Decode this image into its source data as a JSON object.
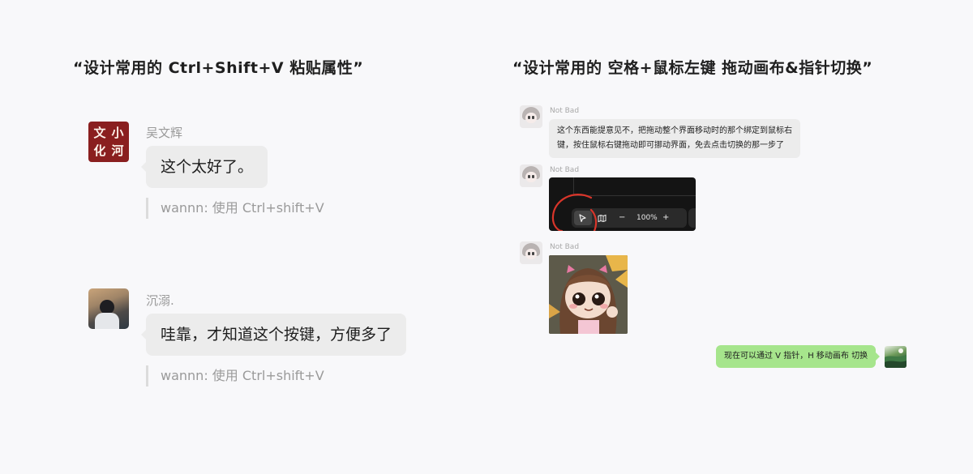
{
  "left": {
    "title": "“设计常用的 Ctrl+Shift+V 粘贴属性”",
    "messages": [
      {
        "avatar_text": [
          "文",
          "小",
          "化",
          "河"
        ],
        "name": "吴文辉",
        "text": "这个太好了。",
        "quote": "wannn: 使用 Ctrl+shift+V"
      },
      {
        "name": "沉溺.",
        "text": "哇靠，才知道这个按键，方便多了",
        "quote": "wannn: 使用 Ctrl+shift+V"
      }
    ]
  },
  "right": {
    "title": "“设计常用的 空格+鼠标左键 拖动画布&指针切换”",
    "messages": [
      {
        "name": "Not Bad",
        "lines": [
          "这个东西能提意见不，把拖动整个界面移动时的那个绑定到鼠标右",
          "键，按住鼠标右键拖动即可挪动界面，免去点击切换的那一步了"
        ]
      },
      {
        "name": "Not Bad",
        "toolbar": {
          "minus": "−",
          "zoom": "100%",
          "plus": "+"
        }
      },
      {
        "name": "Not Bad"
      }
    ],
    "reply": "现在可以通过 V 指针，H 移动画布 切换"
  },
  "colors": {
    "background": "#f8f8fa",
    "bubble_gray": "#ececec",
    "bubble_green": "#a6e58c",
    "seal_red": "#8a1f1f",
    "annotation_red": "#d8352a"
  }
}
